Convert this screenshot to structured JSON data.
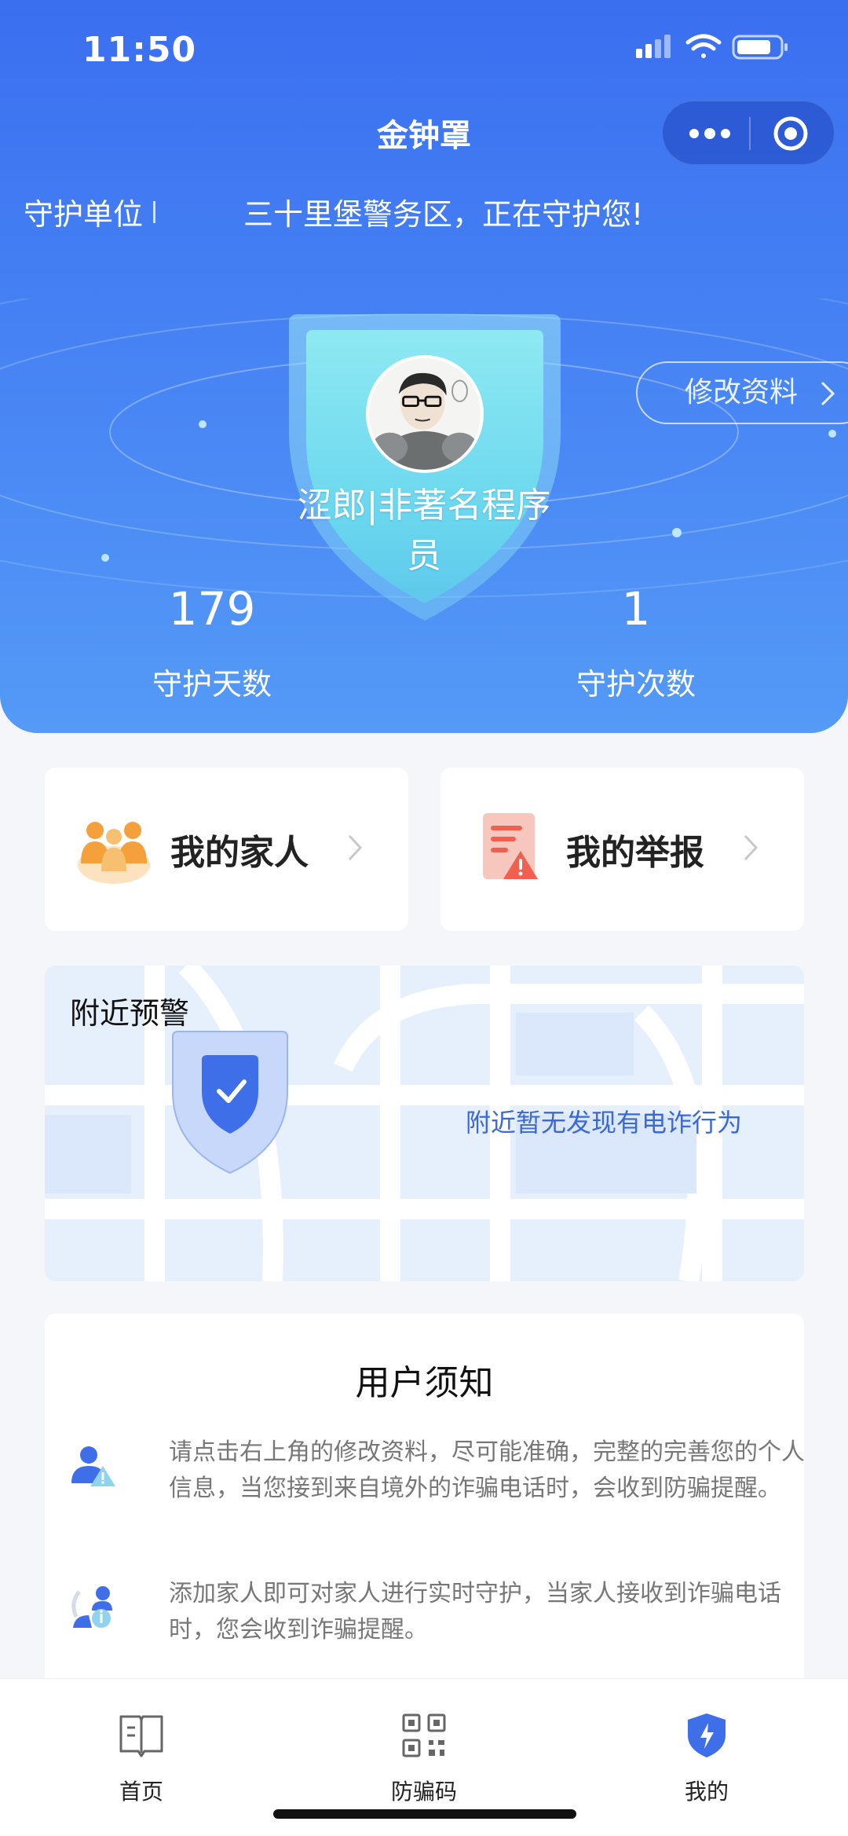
{
  "status_bar": {
    "time": "11:50"
  },
  "nav": {
    "title": "金钟罩"
  },
  "guard": {
    "label": "守护单位",
    "message": "三十里堡警务区，正在守护您!"
  },
  "profile": {
    "nickname": "涩郎|非著名程序员",
    "edit_label": "修改资料"
  },
  "stats": {
    "days": {
      "value": "179",
      "label": "守护天数"
    },
    "times": {
      "value": "1",
      "label": "守护次数"
    }
  },
  "quick_actions": {
    "family": "我的家人",
    "report": "我的举报"
  },
  "nearby_alert": {
    "title": "附近预警",
    "message": "附近暂无发现有电诈行为"
  },
  "notice": {
    "title": "用户须知",
    "items": [
      "请点击右上角的修改资料，尽可能准确，完整的完善您的个人信息，当您接到来自境外的诈骗电话时，会收到防骗提醒。",
      "添加家人即可对家人进行实时守护，当家人接收到诈骗电话时，您会收到诈骗提醒。"
    ]
  },
  "tabbar": {
    "home": "首页",
    "code": "防骗码",
    "mine": "我的"
  },
  "colors": {
    "brand_blue": "#3a6ff0",
    "alert_text": "#3a68d8",
    "report_red": "#f0604f",
    "family_orange": "#f4a13b"
  },
  "icons": [
    "signal-icon",
    "wifi-icon",
    "battery-icon",
    "more-icon",
    "target-icon",
    "chevron-right-icon",
    "family-icon",
    "report-icon",
    "shield-check-icon",
    "user-alert-icon",
    "family-info-icon",
    "book-icon",
    "qrcode-icon",
    "shield-bolt-icon"
  ]
}
